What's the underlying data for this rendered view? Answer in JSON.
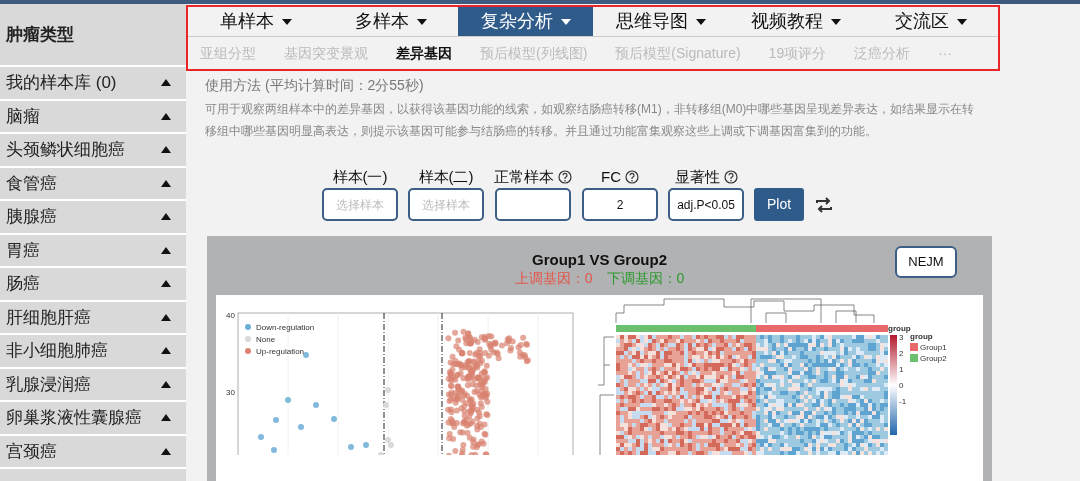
{
  "sidebar": {
    "title": "肿瘤类型",
    "items": [
      {
        "label": "我的样本库 (0)"
      },
      {
        "label": "脑瘤"
      },
      {
        "label": "头颈鳞状细胞癌"
      },
      {
        "label": "食管癌"
      },
      {
        "label": "胰腺癌"
      },
      {
        "label": "胃癌"
      },
      {
        "label": "肠癌"
      },
      {
        "label": "肝细胞肝癌"
      },
      {
        "label": "非小细胞肺癌"
      },
      {
        "label": "乳腺浸润癌"
      },
      {
        "label": "卵巢浆液性囊腺癌"
      },
      {
        "label": "宫颈癌"
      }
    ]
  },
  "nav": {
    "tabs": [
      {
        "label": "单样本",
        "selected": false
      },
      {
        "label": "多样本",
        "selected": false
      },
      {
        "label": "复杂分析",
        "selected": true
      },
      {
        "label": "思维导图",
        "selected": false
      },
      {
        "label": "视频教程",
        "selected": false
      },
      {
        "label": "交流区",
        "selected": false
      }
    ],
    "subtabs": [
      {
        "label": "亚组分型",
        "selected": false
      },
      {
        "label": "基因突变景观",
        "selected": false
      },
      {
        "label": "差异基因",
        "selected": true
      },
      {
        "label": "预后模型(列线图)",
        "selected": false
      },
      {
        "label": "预后模型(Signature)",
        "selected": false
      },
      {
        "label": "19项评分",
        "selected": false
      },
      {
        "label": "泛癌分析",
        "selected": false
      },
      {
        "label": "···",
        "selected": false
      }
    ]
  },
  "usage": {
    "title": "使用方法 (平均计算时间：2分55秒)",
    "description": "可用于观察两组样本中的差异基因，以获得该基因功能的线索，如观察结肠癌转移(M1)，非转移组(M0)中哪些基因呈现差异表达，如结果显示在转移组中哪些基因明显高表达，则提示该基因可能参与结肠癌的转移。并且通过功能富集观察这些上调或下调基因富集到的功能。"
  },
  "form": {
    "fields": [
      {
        "label": "样本(一)",
        "help": false,
        "placeholder": "选择样本"
      },
      {
        "label": "样本(二)",
        "help": false,
        "placeholder": "选择样本"
      },
      {
        "label": "正常样本",
        "help": true
      },
      {
        "label": "FC",
        "help": true,
        "value": "2"
      },
      {
        "label": "显著性",
        "help": true,
        "value": "adj.P<0.05"
      }
    ],
    "button": "Plot"
  },
  "result": {
    "title": "Group1 VS Group2",
    "up": "上调基因：0",
    "down": "下调基因：0",
    "style_button": "NEJM",
    "volcano": {
      "yticks": [
        "40",
        "30"
      ],
      "legend": [
        {
          "label": "Down-regulation",
          "color": "#6baed6"
        },
        {
          "label": "None",
          "color": "#d9d9d9"
        },
        {
          "label": "Up-regulation",
          "color": "#d9826f"
        }
      ]
    },
    "heatmap": {
      "scale_title": "group",
      "scale_ticks": [
        "3",
        "2",
        "1",
        "0",
        "-1"
      ],
      "legend_title": "group",
      "groups": [
        {
          "label": "Group1",
          "color": "#e8696b"
        },
        {
          "label": "Group2",
          "color": "#6cbf6c"
        }
      ]
    }
  }
}
